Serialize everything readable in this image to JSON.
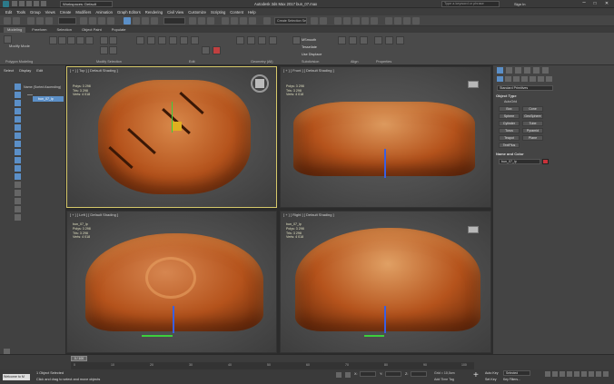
{
  "app": {
    "title": "Autodesk 3ds Max 2017   bun_07.max",
    "workspace": "Workspaces: Default",
    "search_placeholder": "Type a keyword or phrase",
    "signin": "Sign In"
  },
  "menu": [
    "Edit",
    "Tools",
    "Group",
    "Views",
    "Create",
    "Modifiers",
    "Animation",
    "Graph Editors",
    "Rendering",
    "Civil View",
    "Customize",
    "Scripting",
    "Content",
    "Help"
  ],
  "ribbon": {
    "tabs": [
      "Modeling",
      "Freeform",
      "Selection",
      "Object Paint",
      "Populate"
    ],
    "active_tab": "Modeling",
    "groups": [
      "Polygon Modeling",
      "Modify Selection",
      "Edit",
      "Geometry (All)",
      "Subdivision",
      "Align",
      "Properties"
    ],
    "items": {
      "msmooth": "MSmooth",
      "tessellate": "Tessellate",
      "use_displace": "Use Displace"
    },
    "selection_set": "Create Selection Se",
    "modify_mode": "Modify Mode"
  },
  "scene_explorer": {
    "tabs": [
      "Select",
      "Display",
      "Edit"
    ],
    "header": "Name (Sorted Ascending)",
    "items": [
      "bun_07_lp"
    ]
  },
  "viewports": [
    {
      "id": "top",
      "label": "[ + ] [ Top ] [ Default Shading ]",
      "object": "",
      "stats": {
        "polys": "Polys:  3 298",
        "tris": "Tris:  3 298",
        "verts": "Verts:  4 018"
      }
    },
    {
      "id": "front",
      "label": "[ + ] [ Front ] [ Default Shading ]",
      "object": "",
      "stats": {
        "polys": "Polys:  3 298",
        "tris": "Tris:  3 298",
        "verts": "Verts:  4 018"
      }
    },
    {
      "id": "left",
      "label": "[ + ] [ Left ] [ Default Shading ]",
      "object": "bun_07_lp",
      "stats": {
        "polys": "Polys:  3 298",
        "tris": "Tris:  3 298",
        "verts": "Verts:  4 018"
      }
    },
    {
      "id": "right",
      "label": "[ + ] [ Right ] [ Default Shading ]",
      "object": "bun_07_lp",
      "stats": {
        "polys": "Polys:  3 298",
        "tris": "Tris:  3 298",
        "verts": "Verts:  4 018"
      }
    }
  ],
  "command_panel": {
    "dropdown": "Standard Primitives",
    "object_type_header": "Object Type",
    "autogrid": "AutoGrid",
    "buttons": [
      "Box",
      "Cone",
      "Sphere",
      "GeoSphere",
      "Cylinder",
      "Tube",
      "Torus",
      "Pyramid",
      "Teapot",
      "Plane",
      "TextPlus"
    ],
    "name_color_header": "Name and Color",
    "object_name": "bun_07_lp",
    "object_color": "#c8323a"
  },
  "timeline": {
    "frame_display": "0 / 100",
    "ticks": [
      "0",
      "10",
      "20",
      "30",
      "40",
      "50",
      "60",
      "70",
      "80",
      "90",
      "100"
    ]
  },
  "status": {
    "maxscript": "Welcome to M",
    "selected": "1 Object Selected",
    "hint": "Click and drag to select and move objects",
    "x_label": "X:",
    "y_label": "Y:",
    "z_label": "Z:",
    "grid": "Grid = 10,0cm",
    "time_tag": "Add Time Tag",
    "auto_key": "Auto Key",
    "set_key": "Set Key",
    "key_filter": "Selected",
    "key_filters_btn": "Key Filters..."
  },
  "colors": {
    "accent": "#5b8fc7",
    "bread_crust": "#b5531c",
    "bread_highlight": "#e8a060",
    "viewport_bg": "#555555"
  }
}
